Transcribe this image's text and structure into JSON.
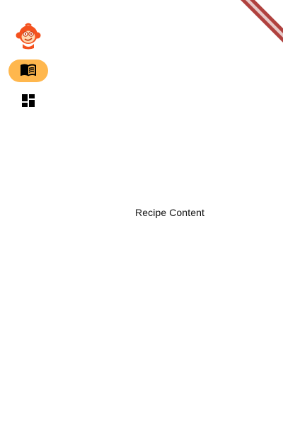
{
  "app": {
    "logo_icon": "monkey-logo-icon",
    "accent_color": "#ffb74d",
    "logo_color": "#f4511e"
  },
  "rail": {
    "destinations": [
      {
        "icon": "menu-book-icon",
        "selected": true
      },
      {
        "icon": "dashboard-icon",
        "selected": false
      }
    ]
  },
  "content": {
    "text": "Recipe Content"
  },
  "debug_banner": {
    "color": "#b0413e"
  }
}
